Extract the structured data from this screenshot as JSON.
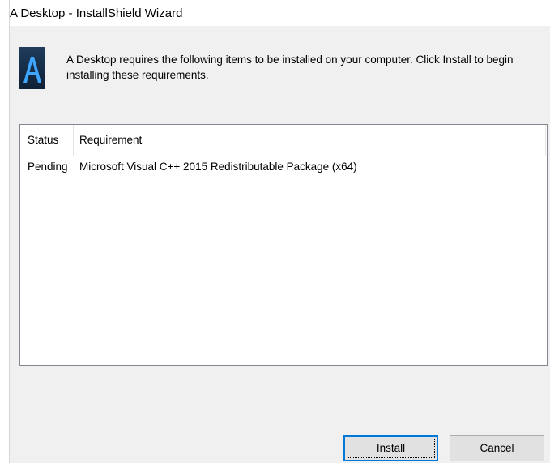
{
  "window": {
    "title": "A Desktop - InstallShield Wizard"
  },
  "header": {
    "icon": "app-logo-a-icon",
    "message": "A Desktop requires the following items to be installed on your computer. Click Install to begin installing these requirements."
  },
  "requirements": {
    "columns": [
      "Status",
      "Requirement"
    ],
    "rows": [
      {
        "status": "Pending",
        "requirement": "Microsoft Visual C++ 2015 Redistributable Package (x64)"
      }
    ]
  },
  "buttons": {
    "install_label": "Install",
    "cancel_label": "Cancel"
  },
  "colors": {
    "dialog_bg": "#f0f0f0",
    "focus_accent": "#0078d7",
    "icon_bg": "#1f3c5c",
    "icon_letter": "#3ea6ff"
  }
}
